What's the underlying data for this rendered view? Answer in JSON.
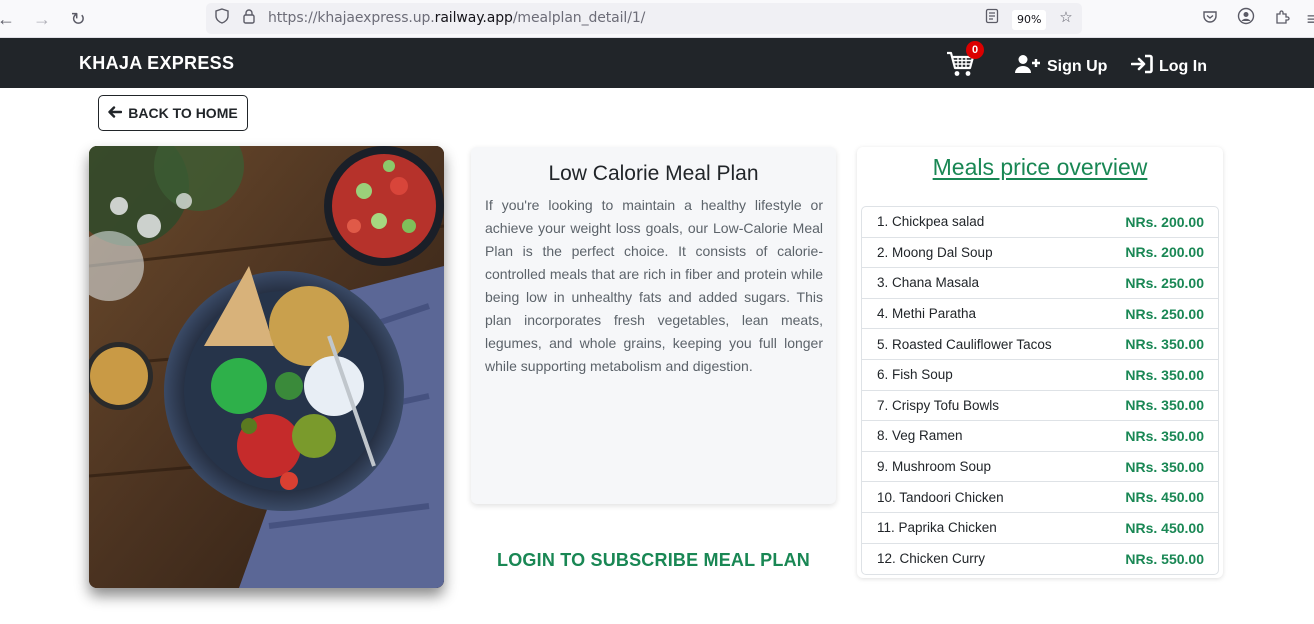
{
  "browser": {
    "url_prefix": "https://khajaexpress.up.",
    "url_domain": "railway.app",
    "url_path": "/mealplan_detail/1/",
    "zoom": "90%"
  },
  "navbar": {
    "brand": "KHAJA EXPRESS",
    "cart_count": "0",
    "signup": "Sign Up",
    "login": "Log In"
  },
  "back_button": "BACK TO HOME",
  "plan": {
    "title": "Low Calorie Meal Plan",
    "description": "If you're looking to maintain a healthy lifestyle or achieve your weight loss goals, our Low-Calorie Meal Plan is the perfect choice. It consists of calorie-controlled meals that are rich in fiber and protein while being low in unhealthy fats and added sugars. This plan incorporates fresh vegetables, lean meats, legumes, and whole grains, keeping you full longer while supporting metabolism and digestion.",
    "subscribe": "LOGIN TO SUBSCRIBE MEAL PLAN"
  },
  "prices": {
    "heading": "Meals price overview",
    "items": [
      {
        "name": "1. Chickpea salad",
        "price": "NRs. 200.00"
      },
      {
        "name": "2. Moong Dal Soup",
        "price": "NRs. 200.00"
      },
      {
        "name": "3. Chana Masala",
        "price": "NRs. 250.00"
      },
      {
        "name": "4. Methi Paratha",
        "price": "NRs. 250.00"
      },
      {
        "name": "5. Roasted Cauliflower Tacos",
        "price": "NRs. 350.00"
      },
      {
        "name": "6. Fish Soup",
        "price": "NRs. 350.00"
      },
      {
        "name": "7. Crispy Tofu Bowls",
        "price": "NRs. 350.00"
      },
      {
        "name": "8. Veg Ramen",
        "price": "NRs. 350.00"
      },
      {
        "name": "9. Mushroom Soup",
        "price": "NRs. 350.00"
      },
      {
        "name": "10. Tandoori Chicken",
        "price": "NRs. 450.00"
      },
      {
        "name": "11. Paprika Chicken",
        "price": "NRs. 450.00"
      },
      {
        "name": "12. Chicken Curry",
        "price": "NRs. 550.00"
      }
    ]
  },
  "colors": {
    "navbar": "#212529",
    "accent_green": "#198754",
    "badge_red": "#dc0000"
  }
}
